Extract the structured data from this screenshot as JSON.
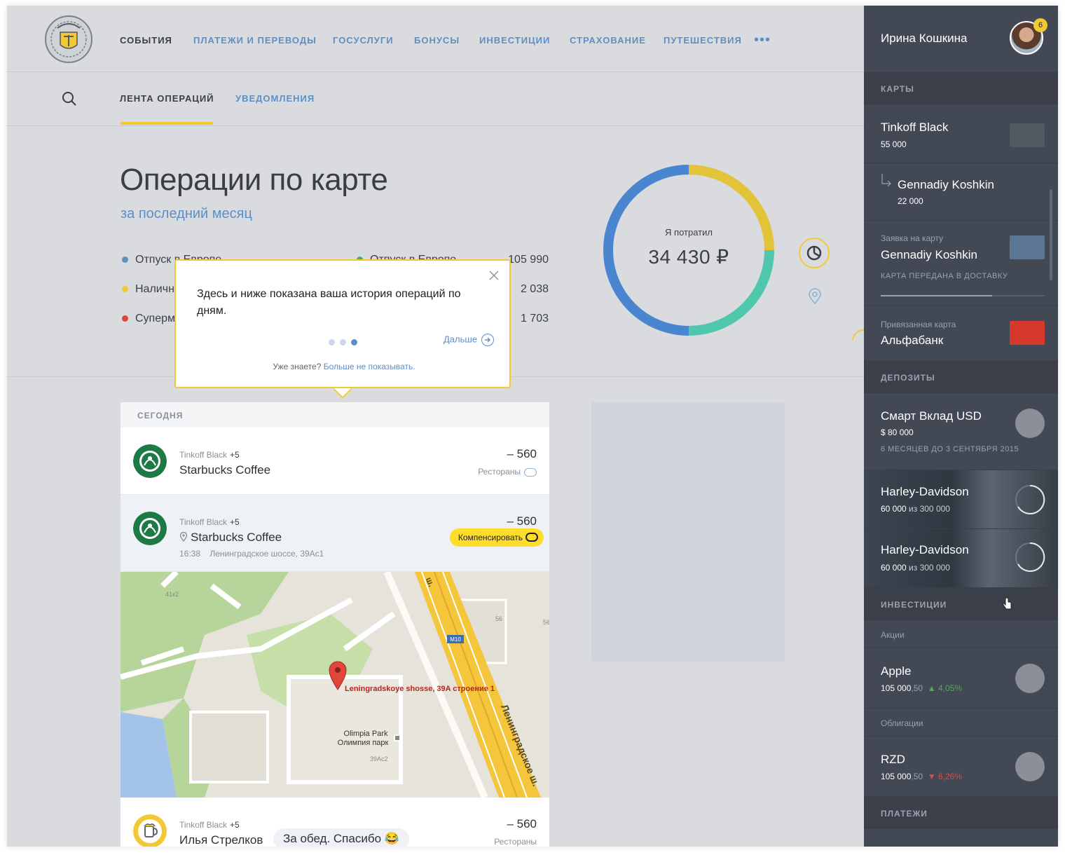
{
  "nav": {
    "items": [
      "СОБЫТИЯ",
      "ПЛАТЕЖИ И ПЕРЕВОДЫ",
      "ГОСУСЛУГИ",
      "БОНУСЫ",
      "ИНВЕСТИЦИИ",
      "СТРАХОВАНИЕ",
      "ПУТЕШЕСТВИЯ"
    ],
    "more": "•••"
  },
  "subnav": {
    "tab_feed": "ЛЕНТА ОПЕРАЦИЙ",
    "tab_notifications": "УВЕДОМЛЕНИЯ"
  },
  "summary": {
    "title": "Операции по карте",
    "subtitle": "за последний месяц",
    "categories_left": [
      {
        "label": "Отпуск в Европе",
        "amount": "105 990",
        "color": "#5e8fc4"
      },
      {
        "label": "Наличные",
        "amount": "2 038",
        "color": "#f2c933"
      },
      {
        "label": "Супермаркеты",
        "amount": "1 703",
        "color": "#d9473d"
      }
    ],
    "categories_right": [
      {
        "label": "Отпуск в Европе",
        "amount": "105 990",
        "color": "#4ab05a"
      },
      {
        "amount": "2 038"
      },
      {
        "amount": "1 703"
      }
    ],
    "spent_label": "Я потратил",
    "spent_value": "34 430 ₽",
    "donut_segments": [
      {
        "share": 0.25,
        "color": "#e2c33a"
      },
      {
        "share": 0.25,
        "color": "#4fc7ad"
      },
      {
        "share": 0.5,
        "color": "#4a86d0"
      }
    ]
  },
  "tooltip": {
    "text": "Здесь и ниже показана ваша история операций по дням.",
    "next": "Дальше",
    "footer_question": "Уже знаете?",
    "footer_link": "Больше не показывать."
  },
  "feed": {
    "day": "СЕГОДНЯ",
    "ops": [
      {
        "card": "Tinkoff Black",
        "bonus": "+5",
        "name": "Starbucks Coffee",
        "amount": "– 560",
        "category": "Рестораны"
      },
      {
        "card": "Tinkoff Black",
        "bonus": "+5",
        "name": "Starbucks Coffee",
        "amount": "– 560",
        "time": "16:38",
        "address": "Ленинградское шоссе, 39Ас1",
        "compensate": "Компенсировать"
      },
      {
        "card": "Tinkoff Black",
        "bonus": "+5",
        "name": "Илья Стрелков",
        "message": "За обед. Спасибо 😂",
        "amount": "– 560",
        "category": "Рестораны"
      }
    ]
  },
  "map": {
    "pin_label": "Leningradskoye shosse, 39A строение 1",
    "road_label": "Ленинградское ш.",
    "road_code": "M10",
    "park_label_1": "Olimpia Park",
    "park_label_2": "Олимпия парк",
    "bld_1": "41к2",
    "bld_2": "56",
    "bld_3": "56",
    "bld_4": "39Ас2",
    "road_top": "ш."
  },
  "sidebar": {
    "user_name": "Ирина Кошкина",
    "notifications": "6",
    "cards_section": "КАРТЫ",
    "cards": [
      {
        "title": "Tinkoff Black",
        "sub": "55 000",
        "color": "#525862"
      },
      {
        "title": "Gennadiy Koshkin",
        "sub": "22 000"
      },
      {
        "label": "Заявка на карту",
        "title": "Gennadiy Koshkin",
        "status": "КАРТА ПЕРЕДАНА В ДОСТАВКУ",
        "progress": 0.68,
        "color": "#5a7694"
      },
      {
        "label": "Привязанная карта",
        "title": "Альфабанк",
        "color": "#d6382c"
      }
    ],
    "deposits_section": "ДЕПОЗИТЫ",
    "deposits": [
      {
        "title": "Смарт Вклад USD",
        "sub": "$ 80 000",
        "note": "6 МЕСЯЦЕВ ДО 3 СЕНТЯБРЯ 2015"
      },
      {
        "title": "Harley-Davidson",
        "sub": "60 000",
        "of": "из 300 000"
      },
      {
        "title": "Harley-Davidson",
        "sub": "60 000",
        "of": "из 300 000"
      }
    ],
    "invest_section": "ИНВЕСТИЦИИ",
    "stocks_label": "Акции",
    "stocks": [
      {
        "title": "Apple",
        "value": "105 000",
        "cents": ",50",
        "change": "4,05%",
        "dir": "up"
      }
    ],
    "bonds_label": "Облигации",
    "bonds": [
      {
        "title": "RZD",
        "value": "105 000",
        "cents": ",50",
        "change": "6,26%",
        "dir": "down"
      }
    ],
    "payments_section": "ПЛАТЕЖИ"
  }
}
